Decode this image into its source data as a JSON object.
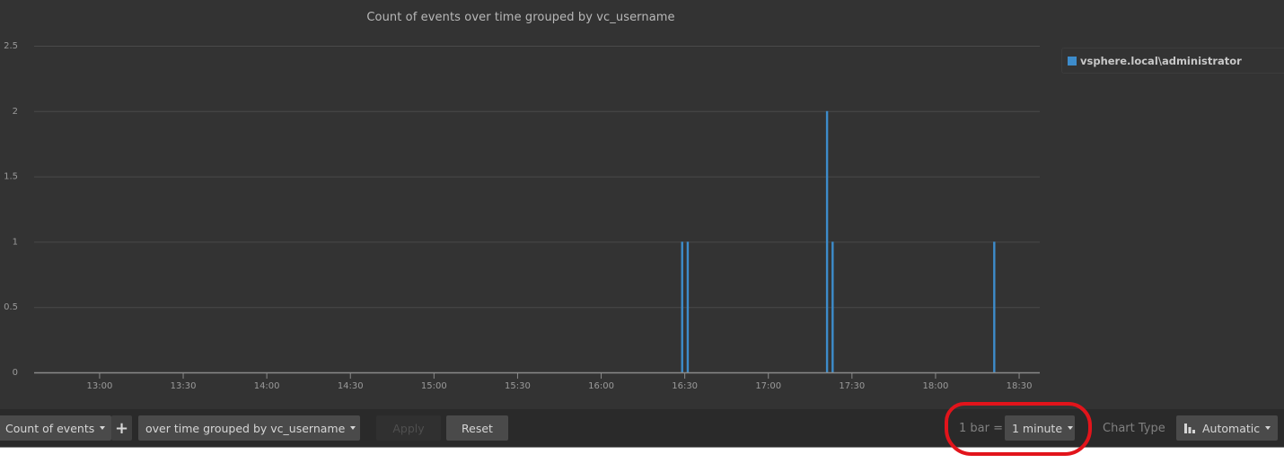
{
  "chart_data": {
    "type": "bar",
    "title": "Count of events over time grouped by vc_username",
    "xlabel": "",
    "ylabel": "",
    "x_axis": {
      "type": "time",
      "range": [
        "12:36",
        "18:37"
      ],
      "tick_labels": [
        "13:00",
        "13:30",
        "14:00",
        "14:30",
        "15:00",
        "15:30",
        "16:00",
        "16:30",
        "17:00",
        "17:30",
        "18:00",
        "18:30"
      ]
    },
    "y_axis": {
      "range": [
        0,
        2.5
      ],
      "tick_labels": [
        "0",
        "0.5",
        "1",
        "1.5",
        "2",
        "2.5"
      ],
      "ticks": [
        0,
        0.5,
        1,
        1.5,
        2,
        2.5
      ]
    },
    "grid": true,
    "legend_position": "right",
    "bin": "1 minute",
    "series": [
      {
        "name": "vsphere.local\\administrator",
        "color": "#3d8ccb",
        "points": [
          {
            "x": "16:29",
            "y": 1
          },
          {
            "x": "16:31",
            "y": 1
          },
          {
            "x": "17:21",
            "y": 2
          },
          {
            "x": "17:23",
            "y": 1
          },
          {
            "x": "18:21",
            "y": 1
          }
        ]
      }
    ]
  },
  "legend": {
    "items": [
      {
        "label": "vsphere.local\\administrator",
        "color": "#3d8ccb"
      }
    ]
  },
  "toolbar": {
    "metric_label": "Count of events",
    "add_label": "+",
    "groupby_label": "over time grouped by vc_username",
    "apply_label": "Apply",
    "reset_label": "Reset",
    "bar_span_prefix": "1 bar =",
    "bar_span_value": "1 minute",
    "chart_type_prefix": "Chart Type",
    "chart_type_value": "Automatic",
    "chart_type_icon": "bar-chart-icon"
  },
  "colors": {
    "background": "#333333",
    "toolbar_bg": "#2a2a2a",
    "series": "#3d8ccb",
    "annotation": "#e2141b"
  }
}
